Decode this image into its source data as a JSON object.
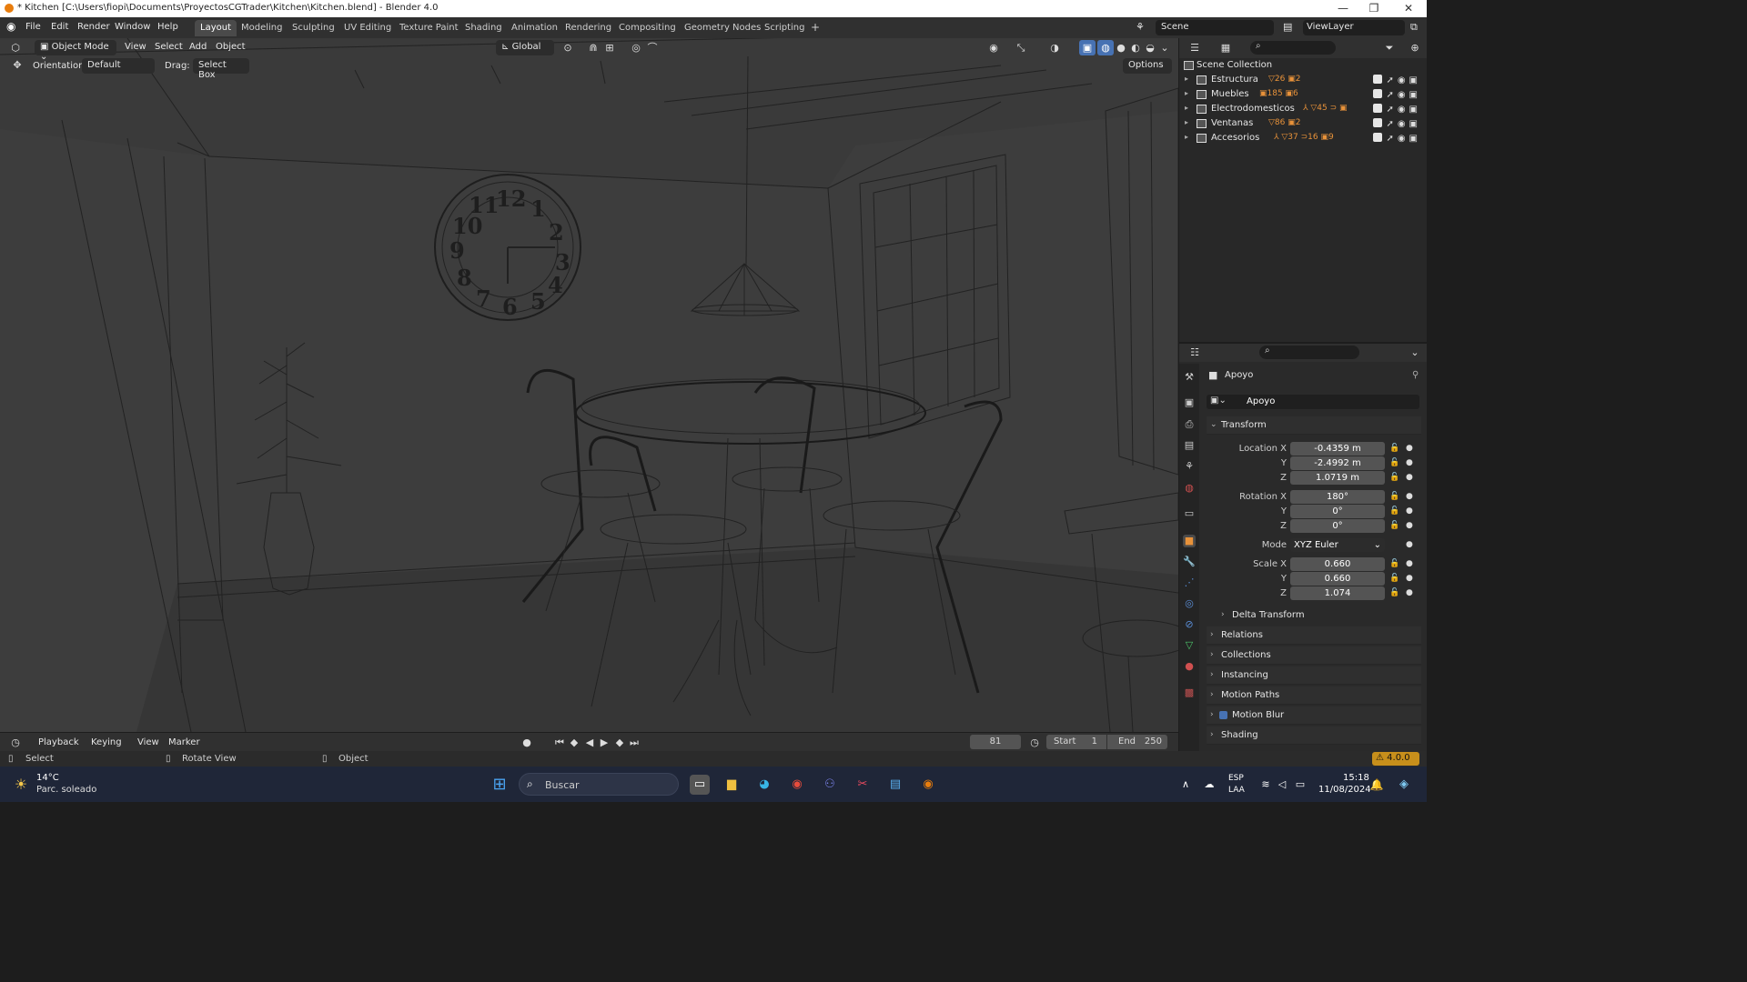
{
  "window": {
    "title": "* Kitchen [C:\\Users\\fiopi\\Documents\\ProyectosCGTrader\\Kitchen\\Kitchen.blend] - Blender 4.0",
    "minimize": "—",
    "maximize": "❐",
    "close": "✕"
  },
  "menu": {
    "items": [
      "File",
      "Edit",
      "Render",
      "Window",
      "Help"
    ]
  },
  "workspaces": {
    "tabs": [
      "Layout",
      "Modeling",
      "Sculpting",
      "UV Editing",
      "Texture Paint",
      "Shading",
      "Animation",
      "Rendering",
      "Compositing",
      "Geometry Nodes",
      "Scripting"
    ],
    "active": "Layout",
    "add_label": "+"
  },
  "scene": {
    "scene_name": "Scene",
    "view_layer": "ViewLayer"
  },
  "viewport": {
    "mode": "Object Mode",
    "menus": [
      "View",
      "Select",
      "Add",
      "Object"
    ],
    "transform_orientation": "Global",
    "orientation_label": "Orientation:",
    "orientation_value": "Default",
    "drag_label": "Drag:",
    "drag_value": "Select Box",
    "options_label": "Options",
    "clock_numbers": [
      "12",
      "1",
      "2",
      "3",
      "4",
      "5",
      "6",
      "7",
      "8",
      "9",
      "10",
      "11"
    ]
  },
  "outliner": {
    "root": "Scene Collection",
    "collections": [
      {
        "name": "Estructura",
        "badges": "▽26 ▣2"
      },
      {
        "name": "Muebles",
        "badges": "▣185 ▣6"
      },
      {
        "name": "Electrodomesticos",
        "badges": "⅄ ▽45 ⊃ ▣"
      },
      {
        "name": "Ventanas",
        "badges": "▽86 ▣2"
      },
      {
        "name": "Accesorios",
        "badges": "⅄ ▽37 ⊃16 ▣9"
      }
    ]
  },
  "properties": {
    "object_name": "Apoyo",
    "data_name": "Apoyo",
    "transform_label": "Transform",
    "location_label": "Location X",
    "location": [
      "-0.4359 m",
      "-2.4992 m",
      "1.0719 m"
    ],
    "rotation_label": "Rotation X",
    "rotation": [
      "180°",
      "0°",
      "0°"
    ],
    "mode_label": "Mode",
    "mode_value": "XYZ Euler",
    "scale_label": "Scale X",
    "scale": [
      "0.660",
      "0.660",
      "1.074"
    ],
    "axis_y": "Y",
    "axis_z": "Z",
    "panels": [
      "Delta Transform",
      "Relations",
      "Collections",
      "Instancing",
      "Motion Paths",
      "Motion Blur",
      "Shading"
    ]
  },
  "timeline": {
    "menus": [
      "Playback",
      "Keying",
      "View",
      "Marker"
    ],
    "current_frame": "81",
    "start_label": "Start",
    "start": "1",
    "end_label": "End",
    "end": "250"
  },
  "statusbar": {
    "select": "Select",
    "rotate": "Rotate View",
    "object": "Object",
    "version": "4.0.0"
  },
  "taskbar": {
    "temperature": "14°C",
    "weather": "Parc. soleado",
    "search_placeholder": "Buscar",
    "lang1": "ESP",
    "lang2": "LAA",
    "time": "15:18",
    "date": "11/08/2024"
  },
  "colors": {
    "accent_blue": "#4772b3",
    "blender_orange": "#e87d0d",
    "viewport_bg": "#3c3c3c",
    "panel_bg": "#2a2a2a"
  }
}
